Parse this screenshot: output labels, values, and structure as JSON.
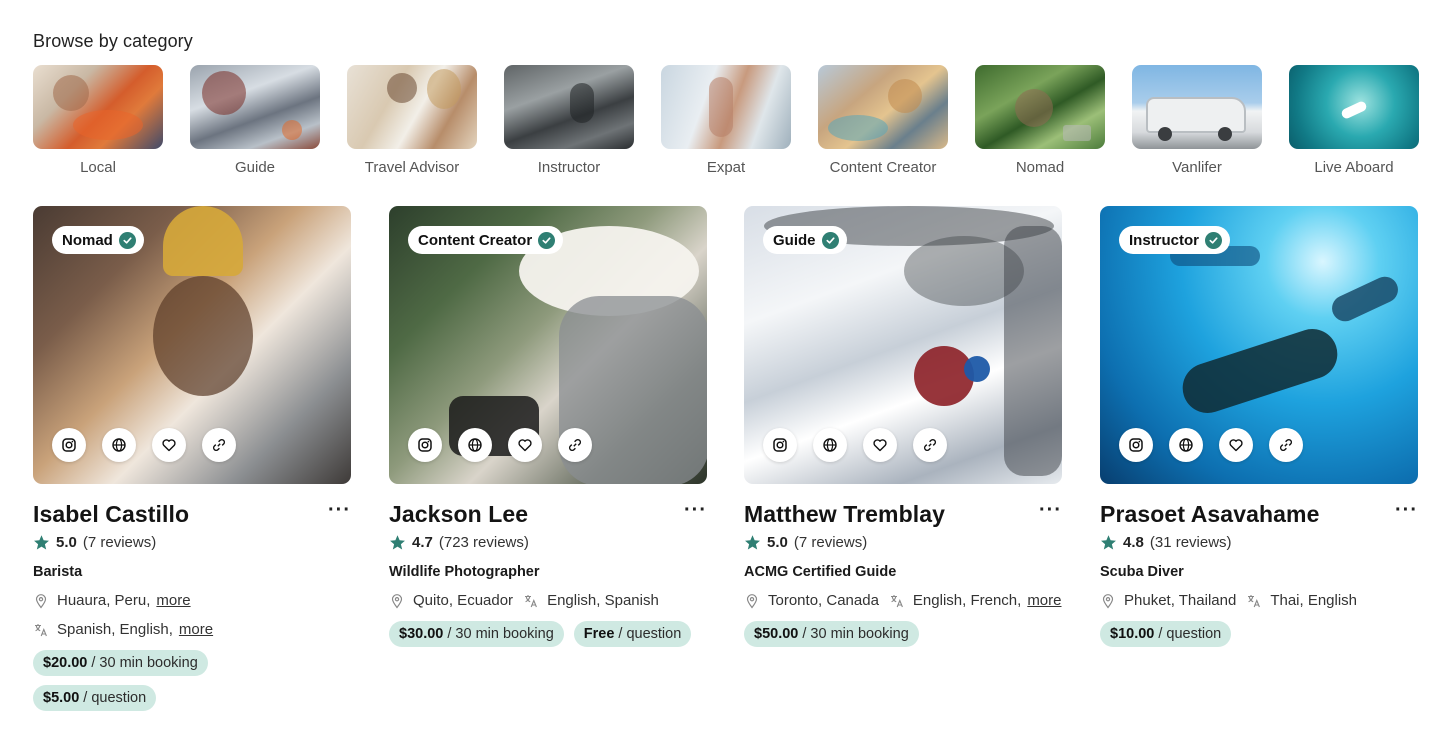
{
  "section_title": "Browse by category",
  "categories": [
    {
      "label": "Local"
    },
    {
      "label": "Guide"
    },
    {
      "label": "Travel Advisor"
    },
    {
      "label": "Instructor"
    },
    {
      "label": "Expat"
    },
    {
      "label": "Content Creator"
    },
    {
      "label": "Nomad"
    },
    {
      "label": "Vanlifer"
    },
    {
      "label": "Live Aboard"
    }
  ],
  "cards": [
    {
      "badge": "Nomad",
      "name": "Isabel Castillo",
      "rating": "5.0",
      "reviews": "(7 reviews)",
      "role": "Barista",
      "location": "Huaura, Peru,",
      "location_more": "more",
      "languages": "Spanish, English,",
      "languages_more": "more",
      "prices": [
        {
          "amount": "$20.00",
          "unit": "/ 30 min booking"
        },
        {
          "amount": "$5.00",
          "unit": "/ question"
        }
      ]
    },
    {
      "badge": "Content Creator",
      "name": "Jackson Lee",
      "rating": "4.7",
      "reviews": "(723 reviews)",
      "role": "Wildlife Photographer",
      "location": "Quito, Ecuador",
      "languages": "English, Spanish",
      "prices": [
        {
          "amount": "$30.00",
          "unit": "/ 30 min booking"
        },
        {
          "amount": "Free",
          "unit": "/ question"
        }
      ]
    },
    {
      "badge": "Guide",
      "name": "Matthew Tremblay",
      "rating": "5.0",
      "reviews": "(7 reviews)",
      "role": "ACMG Certified Guide",
      "location": "Toronto, Canada",
      "languages": "English, French,",
      "languages_more": "more",
      "prices": [
        {
          "amount": "$50.00",
          "unit": "/ 30 min booking"
        }
      ]
    },
    {
      "badge": "Instructor",
      "name": "Prasoet Asavahame",
      "rating": "4.8",
      "reviews": "(31 reviews)",
      "role": "Scuba Diver",
      "location": "Phuket, Thailand",
      "languages": "Thai, English",
      "prices": [
        {
          "amount": "$10.00",
          "unit": "/ question"
        }
      ]
    }
  ],
  "icons": {
    "verified": "check-circle-icon",
    "instagram": "instagram-icon",
    "website": "globe-icon",
    "favorite": "heart-icon",
    "link": "link-icon",
    "rating": "star-icon",
    "location": "map-pin-icon",
    "language": "translate-icon",
    "menu": "ellipsis-icon"
  },
  "colors": {
    "accent": "#2f7f73",
    "price_pill": "#cfe9e2",
    "text": "#1b1b1b"
  }
}
